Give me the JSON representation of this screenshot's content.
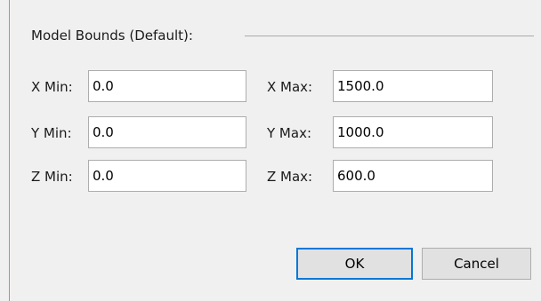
{
  "group": {
    "title": "Model Bounds (Default):"
  },
  "fields": {
    "x_min": {
      "label": "X Min:",
      "value": "0.0"
    },
    "x_max": {
      "label": "X Max:",
      "value": "1500.0"
    },
    "y_min": {
      "label": "Y Min:",
      "value": "0.0"
    },
    "y_max": {
      "label": "Y Max:",
      "value": "1000.0"
    },
    "z_min": {
      "label": "Z Min:",
      "value": "0.0"
    },
    "z_max": {
      "label": "Z Max:",
      "value": "600.0"
    }
  },
  "buttons": {
    "ok": "OK",
    "cancel": "Cancel"
  },
  "colors": {
    "default_button_border": "#0078d7",
    "left_edge": "#5fb0c8"
  }
}
